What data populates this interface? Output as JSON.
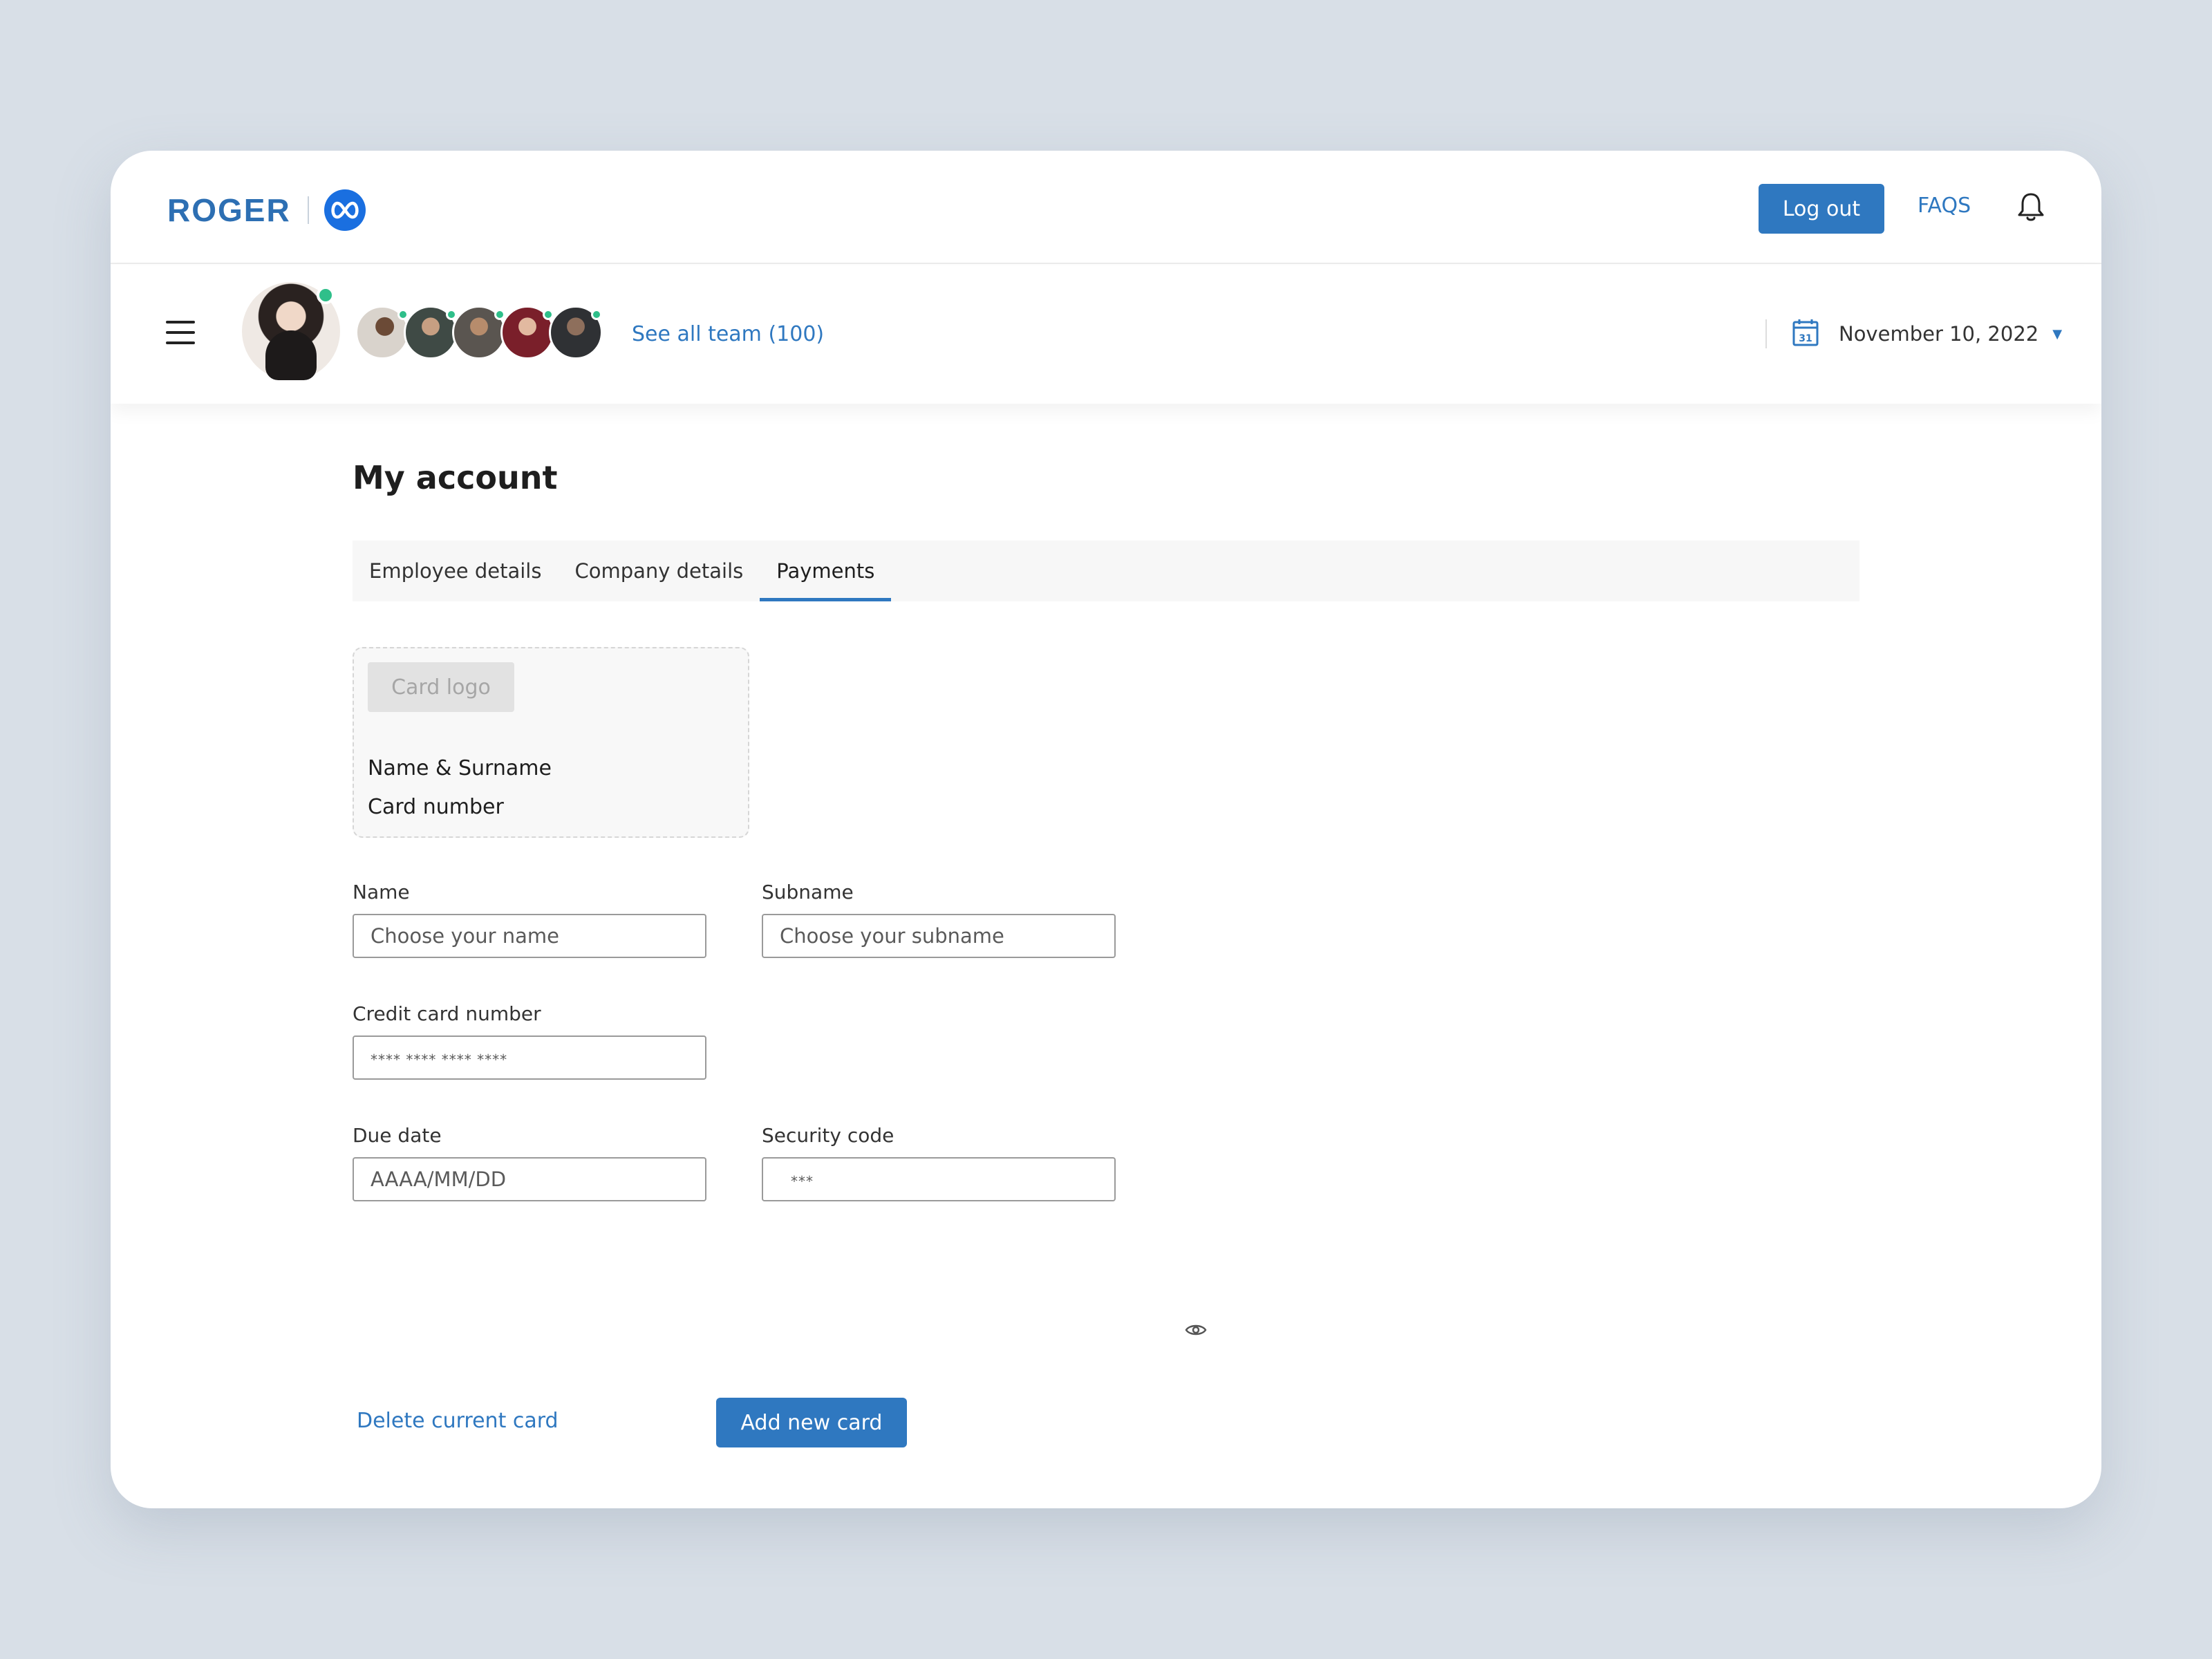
{
  "brand": {
    "name": "ROGER",
    "logo_icon": "meta-infinity-icon",
    "accent": "#2f78c0"
  },
  "header": {
    "logout_label": "Log out",
    "faqs_label": "FAQS",
    "notification_icon": "bell-icon"
  },
  "team": {
    "see_all_label": "See all team (100)",
    "online_color": "#2fbf8a"
  },
  "date_picker": {
    "value": "November 10, 2022",
    "icon": "calendar-icon",
    "calendar_day": "31"
  },
  "page": {
    "title": "My account"
  },
  "tabs": [
    {
      "label": "Employee details",
      "active": false
    },
    {
      "label": "Company details",
      "active": false
    },
    {
      "label": "Payments",
      "active": true
    }
  ],
  "card_preview": {
    "logo_label": "Card logo",
    "name_label": "Name & Surname",
    "number_label": "Card number"
  },
  "form": {
    "name": {
      "label": "Name",
      "placeholder": "Choose your name"
    },
    "subname": {
      "label": "Subname",
      "placeholder": "Choose your subname"
    },
    "card_number": {
      "label": "Credit card number",
      "placeholder": "**** **** **** ****"
    },
    "due_date": {
      "label": "Due date",
      "placeholder": "AAAA/MM/DD"
    },
    "security_code": {
      "label": "Security code",
      "placeholder": "***"
    }
  },
  "actions": {
    "delete_label": "Delete current card",
    "add_label": "Add new card"
  }
}
